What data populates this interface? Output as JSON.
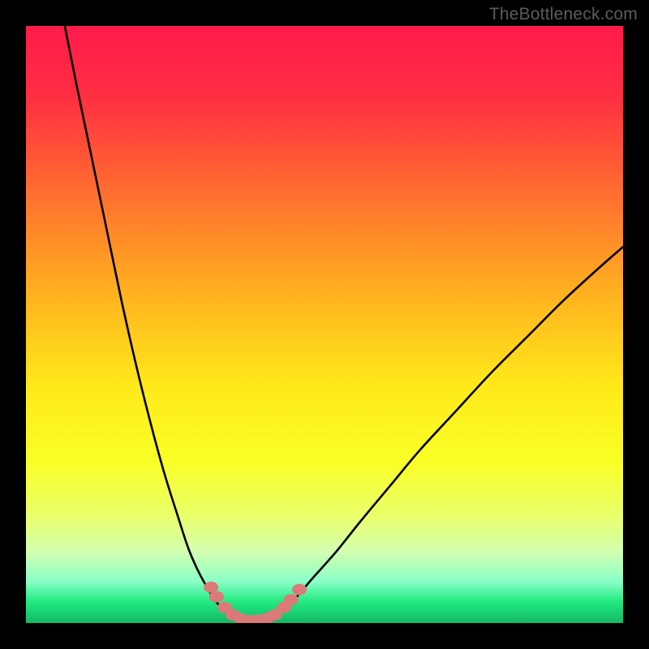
{
  "watermark": "TheBottleneck.com",
  "chart_data": {
    "type": "line",
    "title": "",
    "xlabel": "",
    "ylabel": "",
    "xlim": [
      0,
      100
    ],
    "ylim": [
      0,
      100
    ],
    "gradient_stops": [
      {
        "offset": 0.0,
        "color": "#ff1a4b"
      },
      {
        "offset": 0.12,
        "color": "#ff2f42"
      },
      {
        "offset": 0.28,
        "color": "#ff6e2f"
      },
      {
        "offset": 0.45,
        "color": "#ffb21f"
      },
      {
        "offset": 0.6,
        "color": "#ffe81a"
      },
      {
        "offset": 0.73,
        "color": "#f9ff26"
      },
      {
        "offset": 0.82,
        "color": "#eaff6a"
      },
      {
        "offset": 0.88,
        "color": "#d3ffb0"
      },
      {
        "offset": 0.93,
        "color": "#8affc8"
      },
      {
        "offset": 0.965,
        "color": "#21e981"
      },
      {
        "offset": 1.0,
        "color": "#13b865"
      }
    ],
    "series": [
      {
        "name": "left-curve",
        "x": [
          6.5,
          8.5,
          11,
          13.5,
          16,
          18.5,
          21,
          23.2,
          25.4,
          27.2,
          28.8,
          30.2,
          31.4,
          32.5,
          33.6,
          34.5
        ],
        "y": [
          100,
          90,
          78,
          66,
          54,
          43,
          33,
          25,
          18,
          12.5,
          8.8,
          6.2,
          4.2,
          2.8,
          1.7,
          1.0
        ]
      },
      {
        "name": "floor",
        "x": [
          34.5,
          36,
          38,
          40,
          41.5
        ],
        "y": [
          1.0,
          0.5,
          0.4,
          0.5,
          1.0
        ]
      },
      {
        "name": "right-curve",
        "x": [
          41.5,
          43,
          45,
          48,
          52,
          56,
          61,
          66,
          72,
          78,
          84,
          90,
          96,
          100
        ],
        "y": [
          1.0,
          2.0,
          4.0,
          7.5,
          12,
          17,
          23,
          29,
          35.5,
          42,
          48,
          54,
          59.5,
          63
        ]
      }
    ],
    "markers": [
      {
        "x": 31.0,
        "y": 6.0
      },
      {
        "x": 31.9,
        "y": 4.4
      },
      {
        "x": 33.3,
        "y": 2.6
      },
      {
        "x": 34.6,
        "y": 1.4
      },
      {
        "x": 36.0,
        "y": 0.7
      },
      {
        "x": 37.5,
        "y": 0.45
      },
      {
        "x": 39.0,
        "y": 0.5
      },
      {
        "x": 40.4,
        "y": 0.8
      },
      {
        "x": 41.7,
        "y": 1.4
      },
      {
        "x": 43.2,
        "y": 2.6
      },
      {
        "x": 44.4,
        "y": 3.9
      },
      {
        "x": 45.8,
        "y": 5.6
      }
    ],
    "marker_style": {
      "fill": "#db7a78",
      "rx": 9,
      "ry": 7
    },
    "curve_style": {
      "stroke": "#000000",
      "width": 2.6
    }
  }
}
